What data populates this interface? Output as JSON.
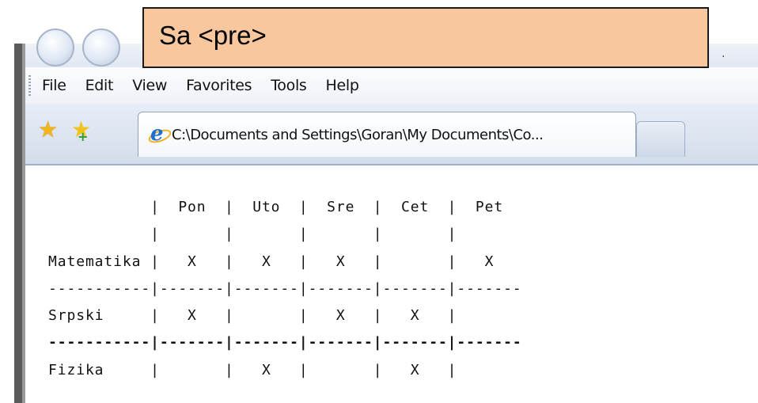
{
  "overlay_label": "Sa <pre>",
  "menu": {
    "items": [
      {
        "label": "File"
      },
      {
        "label": "Edit"
      },
      {
        "label": "View"
      },
      {
        "label": "Favorites"
      },
      {
        "label": "Tools"
      },
      {
        "label": "Help"
      }
    ]
  },
  "tab": {
    "title": "C:\\Documents and Settings\\Goran\\My Documents\\Co..."
  },
  "icons": {
    "favorites": "star-icon",
    "add_favorites": "add-favorite-icon",
    "ie": "internet-explorer-icon",
    "back": "back-button-icon",
    "forward": "forward-button-icon"
  },
  "pre_table": {
    "headers": [
      "",
      "Pon",
      "Uto",
      "Sre",
      "Cet",
      "Pet"
    ],
    "rows": [
      {
        "subject": "Matematika",
        "cells": [
          "X",
          "X",
          "X",
          "",
          "X"
        ]
      },
      {
        "subject": "Srpski",
        "cells": [
          "X",
          "",
          "X",
          "X",
          ""
        ]
      },
      {
        "subject": "Fizika",
        "cells": [
          "",
          "X",
          "",
          "X",
          ""
        ]
      }
    ],
    "lines": [
      "           |  Pon  |  Uto  |  Sre  |  Cet  |  Pet",
      "           |       |       |       |       |",
      "Matematika |   X   |   X   |   X   |       |   X",
      "-----------|-------|-------|-------|-------|-------",
      "Srpski     |   X   |       |   X   |   X   |",
      "-----------|-------|-------|-------|-------|-------",
      "Fizika     |       |   X   |       |   X   |"
    ]
  }
}
